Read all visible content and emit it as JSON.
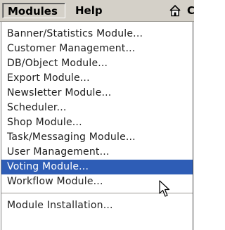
{
  "menubar": {
    "modules_label": "Modules",
    "help_label": "Help",
    "cut_glyph": "C",
    "home_icon": "home-icon"
  },
  "dropdown": {
    "items": [
      {
        "label": "Banner/Statistics Module..."
      },
      {
        "label": "Customer Management..."
      },
      {
        "label": "DB/Object Module..."
      },
      {
        "label": "Export Module..."
      },
      {
        "label": "Newsletter Module..."
      },
      {
        "label": "Scheduler..."
      },
      {
        "label": "Shop Module..."
      },
      {
        "label": "Task/Messaging Module..."
      },
      {
        "label": "User Management..."
      },
      {
        "label": "Voting Module...",
        "highlighted": true
      },
      {
        "label": "Workflow Module..."
      },
      {
        "label": "Module Installation..."
      }
    ]
  },
  "colors": {
    "menubar_background": "#d4d0c8",
    "highlight_background": "#2e5db6",
    "highlight_text": "#ffffff",
    "menu_text": "#202020"
  },
  "cursor_icon": "arrow-cursor-icon"
}
